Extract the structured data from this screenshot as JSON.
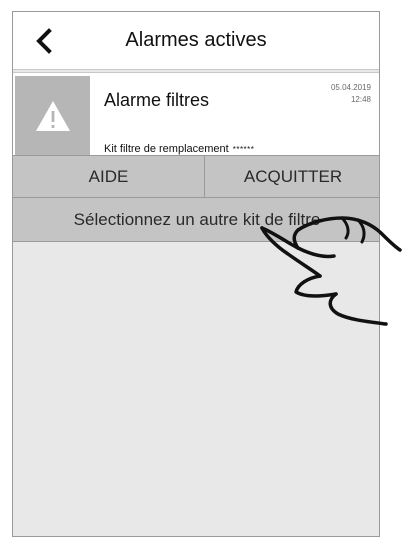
{
  "header": {
    "title": "Alarmes actives",
    "back_icon": "chevron-left-icon"
  },
  "alarm": {
    "name": "Alarme filtres",
    "date": "05.04.2019",
    "time": "12:48",
    "detail": "Kit filtre de remplacement",
    "detail_masked": "******",
    "icon": "warning-triangle-icon"
  },
  "actions": {
    "help_label": "AIDE",
    "acknowledge_label": "ACQUITTER",
    "select_kit_label": "Sélectionnez un autre kit de filtre"
  },
  "overlay": {
    "pointer_icon": "hand-pointer-icon"
  },
  "colors": {
    "background": "#e8e8e8",
    "button": "#c4c4c4",
    "warning_tile": "#b6b6b6",
    "border": "#9a9a9a"
  }
}
